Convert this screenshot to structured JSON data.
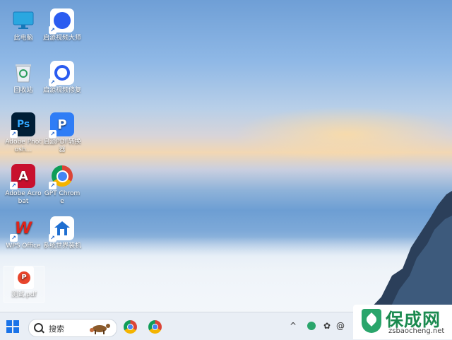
{
  "desktop": {
    "icons": [
      {
        "label": "此电脑",
        "icon": "computer-icon"
      },
      {
        "label": "回收站",
        "icon": "recycle-bin-icon"
      },
      {
        "label": "Adobe Photosh...",
        "icon": "photoshop-icon"
      },
      {
        "label": "Adobe Acrobat",
        "icon": "acrobat-icon"
      },
      {
        "label": "WPS Office",
        "icon": "wps-icon"
      },
      {
        "label": "测试.pdf",
        "icon": "pdf-file-icon"
      },
      {
        "label": "启源视频大师",
        "icon": "video-master-icon"
      },
      {
        "label": "启源视频修复",
        "icon": "video-repair-icon"
      },
      {
        "label": "启源PDF转换器",
        "icon": "pdf-converter-icon"
      },
      {
        "label": "GPT Chrome",
        "icon": "chrome-icon"
      },
      {
        "label": "系统世界装机",
        "icon": "system-installer-icon"
      }
    ]
  },
  "taskbar": {
    "search_placeholder": "搜索"
  },
  "watermark": {
    "brand": "保成网",
    "url": "zsbaocheng.net"
  }
}
